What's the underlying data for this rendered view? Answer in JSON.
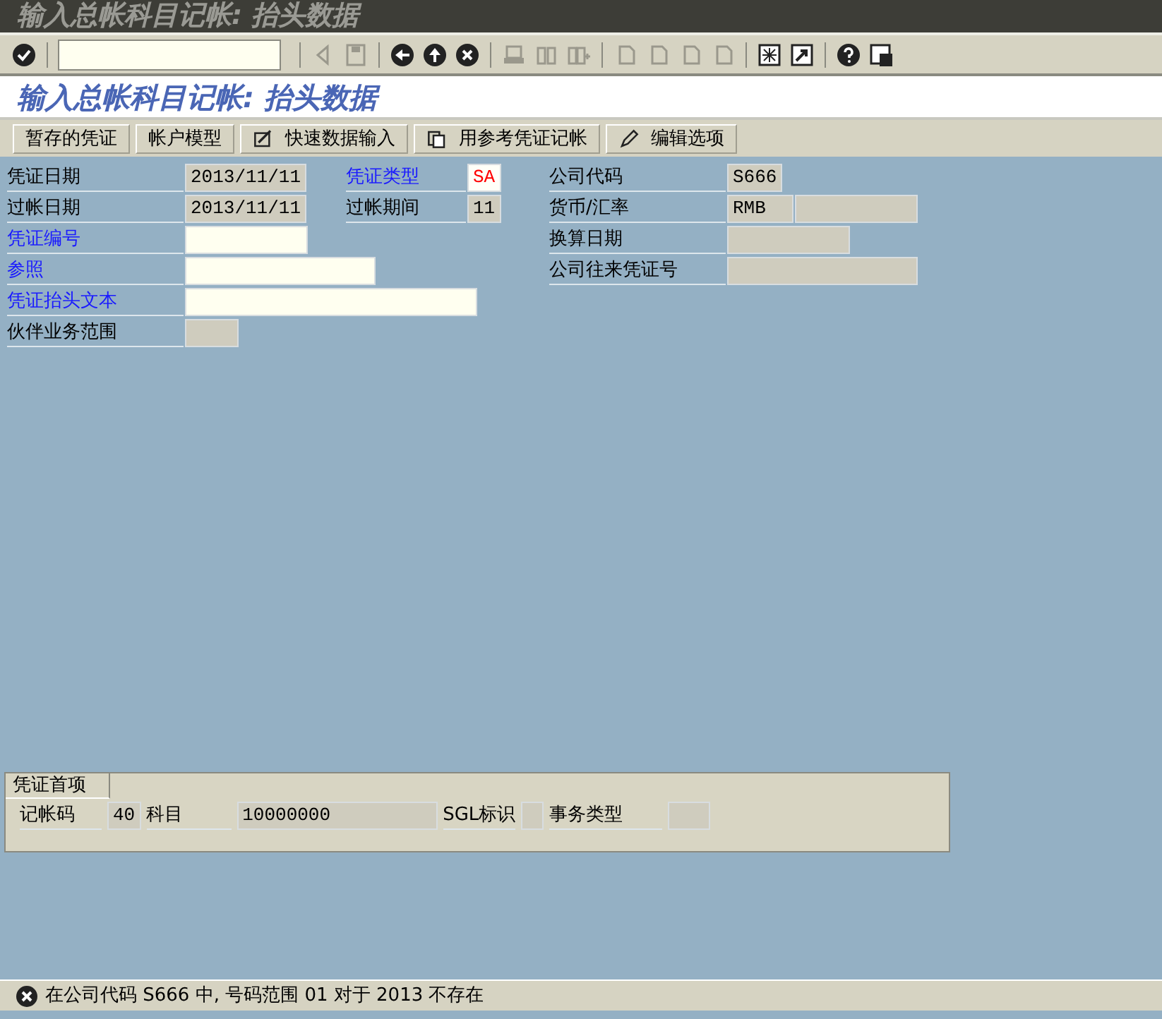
{
  "window": {
    "title": "输入总帐科目记帐: 抬头数据"
  },
  "screen_title": "输入总帐科目记帐: 抬头数据",
  "app_toolbar": [
    {
      "label": "暂存的凭证",
      "kind": "plain"
    },
    {
      "label": "帐户模型",
      "kind": "plain"
    },
    {
      "label": "快速数据输入",
      "kind": "with-icon"
    },
    {
      "label": "用参考凭证记帐",
      "kind": "with-icon"
    },
    {
      "label": "编辑选项",
      "kind": "with-icon"
    }
  ],
  "header": {
    "columns": [
      [
        {
          "label": "凭证日期",
          "required": false,
          "boxes": [
            {
              "kind": "display",
              "value": "2013/11/11"
            }
          ]
        },
        {
          "label": "过帐日期",
          "required": false,
          "boxes": [
            {
              "kind": "display",
              "value": "2013/11/11"
            }
          ]
        },
        {
          "label": "凭证编号",
          "required": true,
          "boxes": [
            {
              "kind": "input"
            }
          ]
        },
        {
          "label": "参照",
          "required": true,
          "boxes": [
            {
              "kind": "input"
            }
          ]
        },
        {
          "label": "凭证抬头文本",
          "required": true,
          "boxes": [
            {
              "kind": "input"
            }
          ]
        },
        {
          "label": "伙伴业务范围",
          "required": false,
          "boxes": [
            {
              "kind": "display"
            }
          ]
        }
      ],
      [
        {
          "label": "凭证类型",
          "required": true,
          "boxes": [
            {
              "kind": "required-value",
              "value": "SA",
              "color": "#ff0000"
            }
          ]
        },
        {
          "label": "过帐期间",
          "required": false,
          "boxes": [
            {
              "kind": "display",
              "value": "11"
            }
          ]
        }
      ],
      [
        {
          "label": "公司代码",
          "required": false,
          "boxes": [
            {
              "kind": "display",
              "value": "S666"
            }
          ]
        },
        {
          "label": "货币/汇率",
          "required": false,
          "boxes": [
            {
              "kind": "display",
              "value": "RMB"
            },
            {
              "kind": "display"
            }
          ]
        },
        {
          "label": "换算日期",
          "required": false,
          "boxes": [
            {
              "kind": "display"
            }
          ]
        },
        {
          "label": "公司往来凭证号",
          "required": false,
          "boxes": [
            {
              "kind": "display"
            }
          ]
        }
      ]
    ]
  },
  "first_item": {
    "title": "凭证首项",
    "fields": [
      {
        "label": "记帐码",
        "boxes": [
          {
            "kind": "display",
            "value": "40"
          }
        ]
      },
      {
        "label": "科目",
        "boxes": [
          {
            "kind": "display",
            "value": "10000000"
          }
        ]
      },
      {
        "label": "SGL标识",
        "boxes": [
          {
            "kind": "display"
          }
        ]
      },
      {
        "label": "事务类型",
        "boxes": [
          {
            "kind": "display"
          }
        ]
      }
    ]
  },
  "status_bar": {
    "kind": "error",
    "text": "在公司代码 S666 中, 号码范围 01 对于 2013 不存在"
  }
}
